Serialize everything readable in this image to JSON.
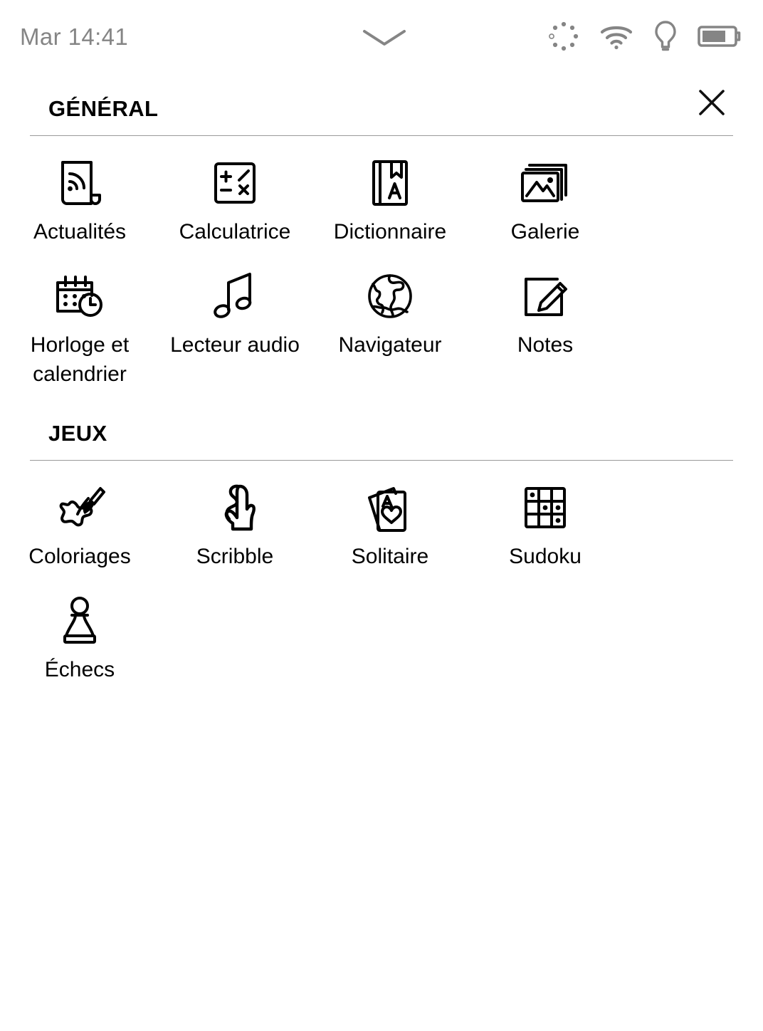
{
  "statusbar": {
    "time": "Mar 14:41",
    "chevron_icon": "chevron-down-icon",
    "icons": [
      {
        "name": "sync-spinner-icon",
        "label": "Synchronisation"
      },
      {
        "name": "wifi-icon",
        "label": "Wi-Fi"
      },
      {
        "name": "frontlight-bulb-icon",
        "label": "Éclairage"
      },
      {
        "name": "battery-icon",
        "label": "Batterie",
        "level_percent": 65
      }
    ]
  },
  "header": {
    "close_icon": "close-icon",
    "close_label": "Fermer"
  },
  "sections": [
    {
      "id": "general",
      "title": "GÉNÉRAL",
      "apps": [
        {
          "label": "Actualités",
          "icon": "rss-news-icon"
        },
        {
          "label": "Calculatrice",
          "icon": "calculator-icon"
        },
        {
          "label": "Dictionnaire",
          "icon": "dictionary-book-icon"
        },
        {
          "label": "Galerie",
          "icon": "gallery-photos-icon"
        },
        {
          "label": "Horloge et calendrier",
          "icon": "clock-calendar-icon"
        },
        {
          "label": "Lecteur audio",
          "icon": "music-note-icon"
        },
        {
          "label": "Navigateur",
          "icon": "globe-browser-icon"
        },
        {
          "label": "Notes",
          "icon": "notes-pencil-icon"
        }
      ]
    },
    {
      "id": "jeux",
      "title": "JEUX",
      "apps": [
        {
          "label": "Coloriages",
          "icon": "paintbrush-splash-icon"
        },
        {
          "label": "Scribble",
          "icon": "hand-scribble-icon"
        },
        {
          "label": "Solitaire",
          "icon": "playing-cards-icon"
        },
        {
          "label": "Sudoku",
          "icon": "sudoku-grid-icon"
        },
        {
          "label": "Échecs",
          "icon": "chess-pawn-icon"
        }
      ]
    }
  ],
  "colors": {
    "background": "#ffffff",
    "foreground": "#000000",
    "status_gray": "#858585",
    "rule_gray": "#9a9a9a"
  }
}
